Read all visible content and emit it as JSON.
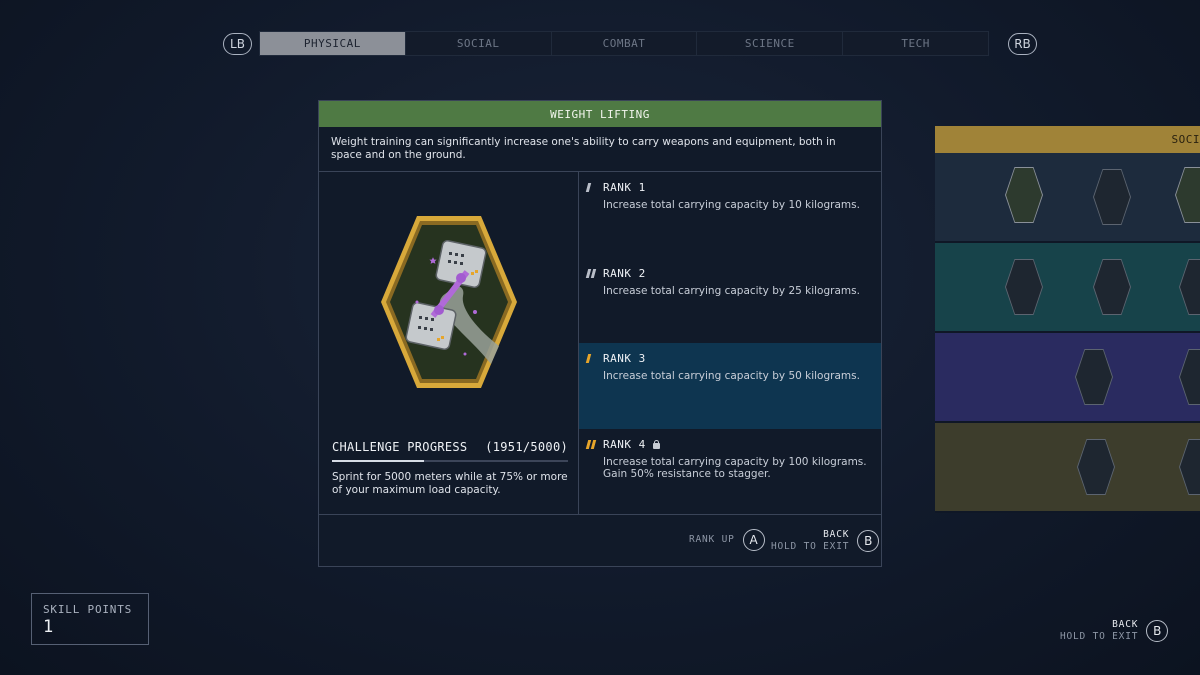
{
  "nav": {
    "left_bumper": "LB",
    "right_bumper": "RB",
    "tabs": [
      {
        "label": "PHYSICAL",
        "active": true
      },
      {
        "label": "SOCIAL",
        "active": false
      },
      {
        "label": "COMBAT",
        "active": false
      },
      {
        "label": "SCIENCE",
        "active": false
      },
      {
        "label": "TECH",
        "active": false
      }
    ]
  },
  "skill": {
    "title": "WEIGHT LIFTING",
    "description": "Weight training can significantly increase one's ability to carry weapons and equipment, both in space and on the ground.",
    "badge_icon": "dumbbell-hand-icon",
    "challenge": {
      "label": "CHALLENGE PROGRESS",
      "progress_text": "(1951/5000)",
      "current": 1951,
      "target": 5000,
      "description": "Sprint for 5000 meters while at 75% or more of your maximum load capacity."
    },
    "ranks": [
      {
        "title": "RANK 1",
        "description": "Increase total carrying capacity by 10 kilograms.",
        "state": "unlocked",
        "pips": 1
      },
      {
        "title": "RANK 2",
        "description": "Increase total carrying capacity by 25 kilograms.",
        "state": "unlocked",
        "pips": 2
      },
      {
        "title": "RANK 3",
        "description": "Increase total carrying capacity by 50 kilograms.",
        "state": "current",
        "pips": 1
      },
      {
        "title": "RANK 4",
        "description": "Increase total carrying capacity by 100 kilograms. Gain 50% resistance to stagger.",
        "state": "locked",
        "pips": 2
      }
    ]
  },
  "actions": {
    "rank_up_label": "RANK UP",
    "rank_up_button": "A",
    "back_label": "BACK",
    "hold_label": "HOLD TO EXIT",
    "back_button": "B"
  },
  "side_panel": {
    "header": "SOCI"
  },
  "skill_points": {
    "label": "SKILL POINTS",
    "value": "1"
  },
  "global_back": {
    "back_label": "BACK",
    "hold_label": "HOLD TO EXIT",
    "button": "B"
  },
  "colors": {
    "accent_green": "#4f7a44",
    "current_rank_bg": "#0e3550",
    "rank_pip_gold": "#e6a52a",
    "badge_gold": "#d8a93a",
    "side_header_gold": "#a08338"
  }
}
